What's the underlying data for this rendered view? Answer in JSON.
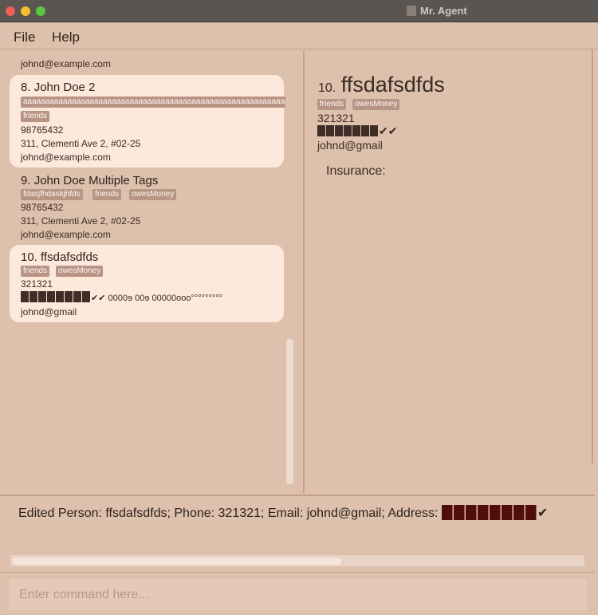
{
  "window": {
    "title": "Mr. Agent"
  },
  "menu": {
    "file": "File",
    "help": "Help"
  },
  "list": {
    "top_email": "johnd@example.com",
    "cards": [
      {
        "index": "8.",
        "name": "John Doe 2",
        "tags": [
          "aaaaaaaaaaaaaaaaaaaaaaaaaaaaaaaaaaaaaaaaaaaaaaaaaaaaaaaaaaaaaaaaaaaaaaaaaaaa",
          "friends"
        ],
        "phone": "98765432",
        "address": "311, Clementi Ave 2, #02-25",
        "email": "johnd@example.com"
      },
      {
        "index": "9.",
        "name": "John Doe Multiple Tags",
        "tags": [
          "fdasjfhdaskjhfds",
          "friends",
          "owesMoney"
        ],
        "phone": "98765432",
        "address": "311, Clementi Ave 2, #02-25",
        "email": "johnd@example.com"
      },
      {
        "index": "10.",
        "name": "ffsdafsdfds",
        "tags": [
          "friends",
          "owesMoney"
        ],
        "phone": "321321",
        "address_tail": "✔✔ 0000ɘ 00ɘ 00000ooo°°°°°°°°°",
        "email": "johnd@gmail"
      }
    ]
  },
  "detail": {
    "index": "10.",
    "name": "ffsdafsdfds",
    "tags": [
      "friends",
      "owesMoney"
    ],
    "phone": "321321",
    "address_tail": "✔✔",
    "email": "johnd@gmail",
    "insurance_label": "Insurance:"
  },
  "result": {
    "text": "Edited Person: ffsdafsdfds; Phone: 321321; Email: johnd@gmail; Address:",
    "tail": "✔"
  },
  "command": {
    "placeholder": "Enter command here..."
  }
}
